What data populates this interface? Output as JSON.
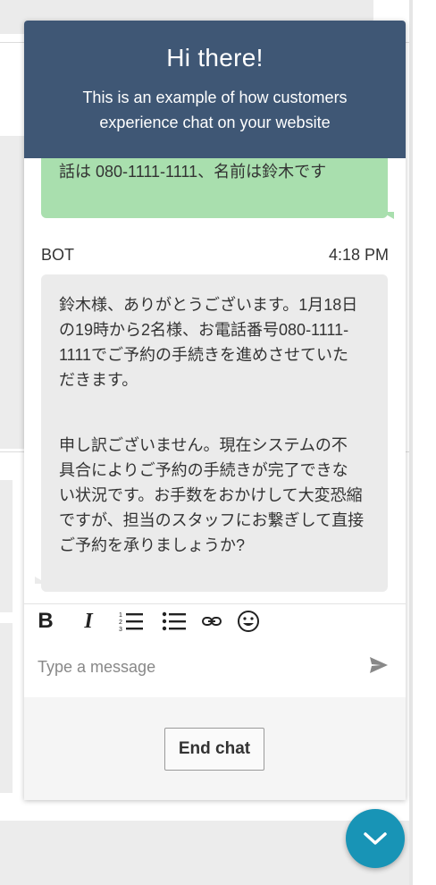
{
  "header": {
    "title": "Hi there!",
    "subtitle": "This is an example of how customers experience chat on your website"
  },
  "messages": {
    "user": {
      "text": "話は 080-1111-1111、名前は鈴木です"
    },
    "bot": {
      "sender": "BOT",
      "time": "4:18 PM",
      "paragraph_1": "鈴木様、ありがとうございます。1月18日\nの19時から2名様、お電話番号080-1111-\n1111でご予約の手続きを進めさせていた\nだきます。",
      "paragraph_2": "申し訳ございません。現在システムの不\n具合によりご予約の手続きが完了できな\nい状況です。お手数をおかけして大変恐縮\nですが、担当のスタッフにお繋ぎして直接\nご予約を承りましょうか?"
    }
  },
  "toolbar": {
    "icons": [
      "bold-icon",
      "italic-icon",
      "numbered-list-icon",
      "bulleted-list-icon",
      "link-icon",
      "emoji-icon"
    ]
  },
  "composer": {
    "placeholder": "Type a message",
    "value": ""
  },
  "footer": {
    "end_chat_label": "End chat"
  },
  "colors": {
    "header_bg": "#3f5775",
    "user_bubble": "#a9dfae",
    "bot_bubble": "#ebebeb",
    "fab": "#1894b6"
  }
}
